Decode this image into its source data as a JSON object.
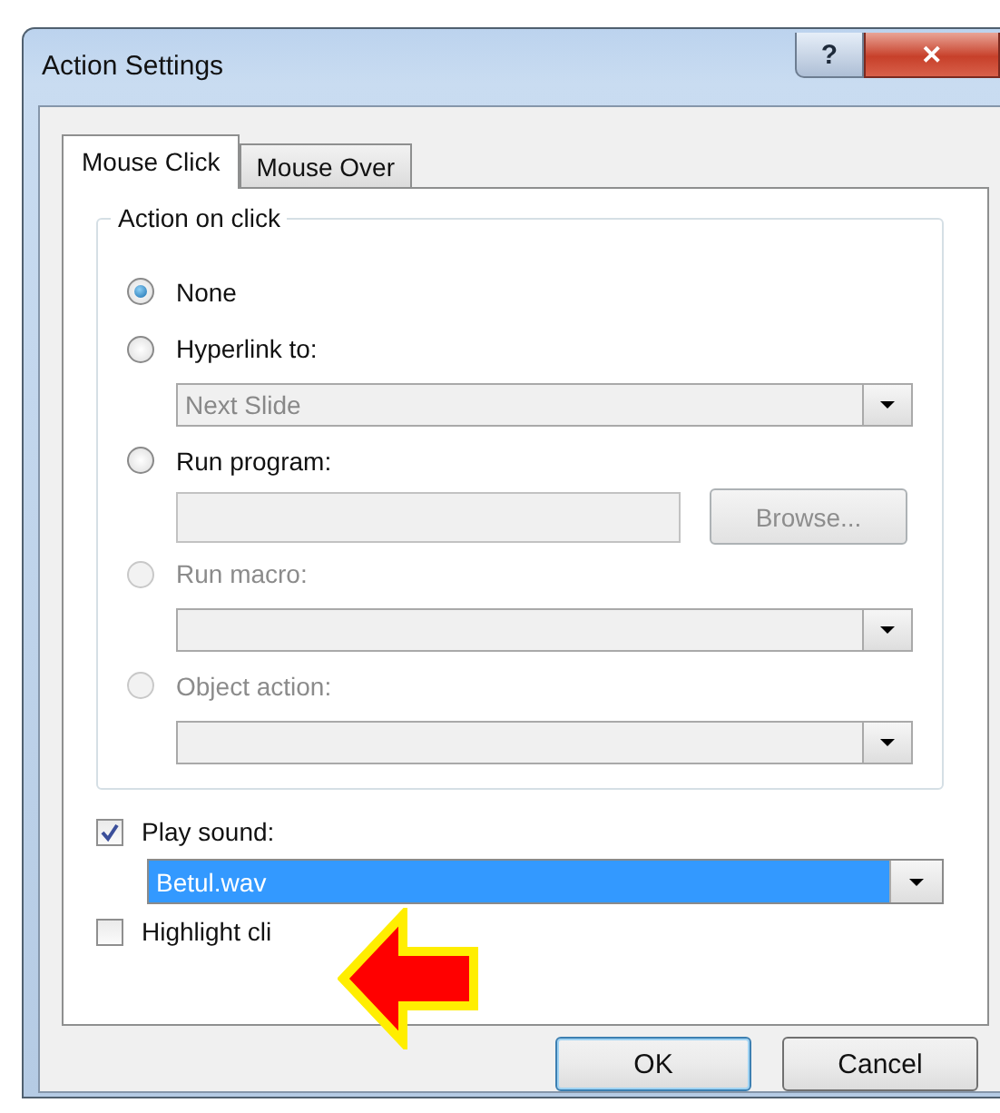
{
  "window": {
    "title": "Action Settings",
    "help_button": "?",
    "close_button": "✕"
  },
  "tabs": [
    {
      "label": "Mouse Click",
      "selected": true
    },
    {
      "label": "Mouse Over",
      "selected": false
    }
  ],
  "action_group": {
    "title": "Action on click",
    "options": [
      {
        "label": "None",
        "selected": true,
        "disabled": false
      },
      {
        "label": "Hyperlink to:",
        "selected": false,
        "disabled": false,
        "control": {
          "kind": "dropdown",
          "value": "Next Slide",
          "disabled": true
        }
      },
      {
        "label": "Run program:",
        "selected": false,
        "disabled": false,
        "control": {
          "kind": "file",
          "button": "Browse...",
          "disabled": true
        }
      },
      {
        "label": "Run macro:",
        "selected": false,
        "disabled": true,
        "control": {
          "kind": "dropdown",
          "disabled": true
        }
      },
      {
        "label": "Object action:",
        "selected": false,
        "disabled": true,
        "control": {
          "kind": "dropdown",
          "disabled": true
        }
      }
    ]
  },
  "play_sound": {
    "label": "Play sound:",
    "checked": true,
    "sound": {
      "value": "Betul.wav",
      "highlighted": true
    }
  },
  "highlight_click": {
    "label": "Highlight cli",
    "checked": false
  },
  "buttons": [
    {
      "label": "OK",
      "default": true
    },
    {
      "label": "Cancel",
      "default": false
    }
  ]
}
